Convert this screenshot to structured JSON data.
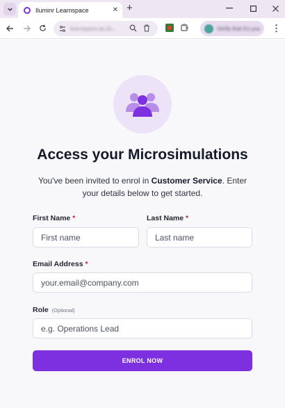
{
  "browser": {
    "tab_title": "Iluminr Learnspace",
    "tab_close": "✕",
    "new_tab": "+",
    "address": "learnspace.au.ilu...",
    "profile_text": "Verify that it's you",
    "menu_glyph": "⋮"
  },
  "page": {
    "title": "Access your Microsimulations",
    "subtitle_pre": "You've been invited to enrol in ",
    "subtitle_bold": "Customer Service",
    "subtitle_post": ". Enter your details below to get started.",
    "form": {
      "first_name_label": "First Name",
      "first_name_placeholder": "First name",
      "last_name_label": "Last Name",
      "last_name_placeholder": "Last name",
      "email_label": "Email Address",
      "email_placeholder": "your.email@company.com",
      "role_label": "Role",
      "role_optional": "(Optional)",
      "role_placeholder": "e.g. Operations Lead",
      "required_marker": "*",
      "submit_label": "ENROL NOW"
    }
  },
  "colors": {
    "accent": "#7c30e0",
    "accent_light": "#ece3f8",
    "required": "#c7263b"
  }
}
